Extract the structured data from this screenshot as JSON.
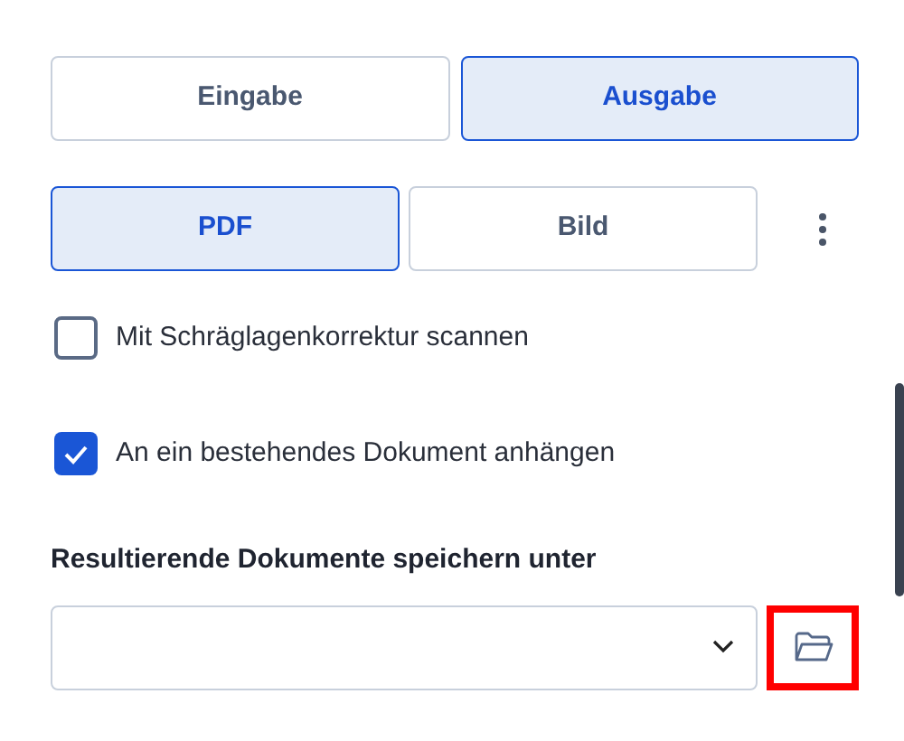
{
  "mode_tabs": [
    {
      "label": "Eingabe",
      "selected": false
    },
    {
      "label": "Ausgabe",
      "selected": true
    }
  ],
  "format_tabs": [
    {
      "label": "PDF",
      "selected": true
    },
    {
      "label": "Bild",
      "selected": false
    }
  ],
  "options": [
    {
      "label": "Mit Schräglagenkorrektur scannen",
      "checked": false
    },
    {
      "label": "An ein bestehendes Dokument anhängen",
      "checked": true
    }
  ],
  "save_location": {
    "label": "Resultierende Dokumente speichern unter",
    "browse_button": {
      "highlighted": true
    }
  }
}
